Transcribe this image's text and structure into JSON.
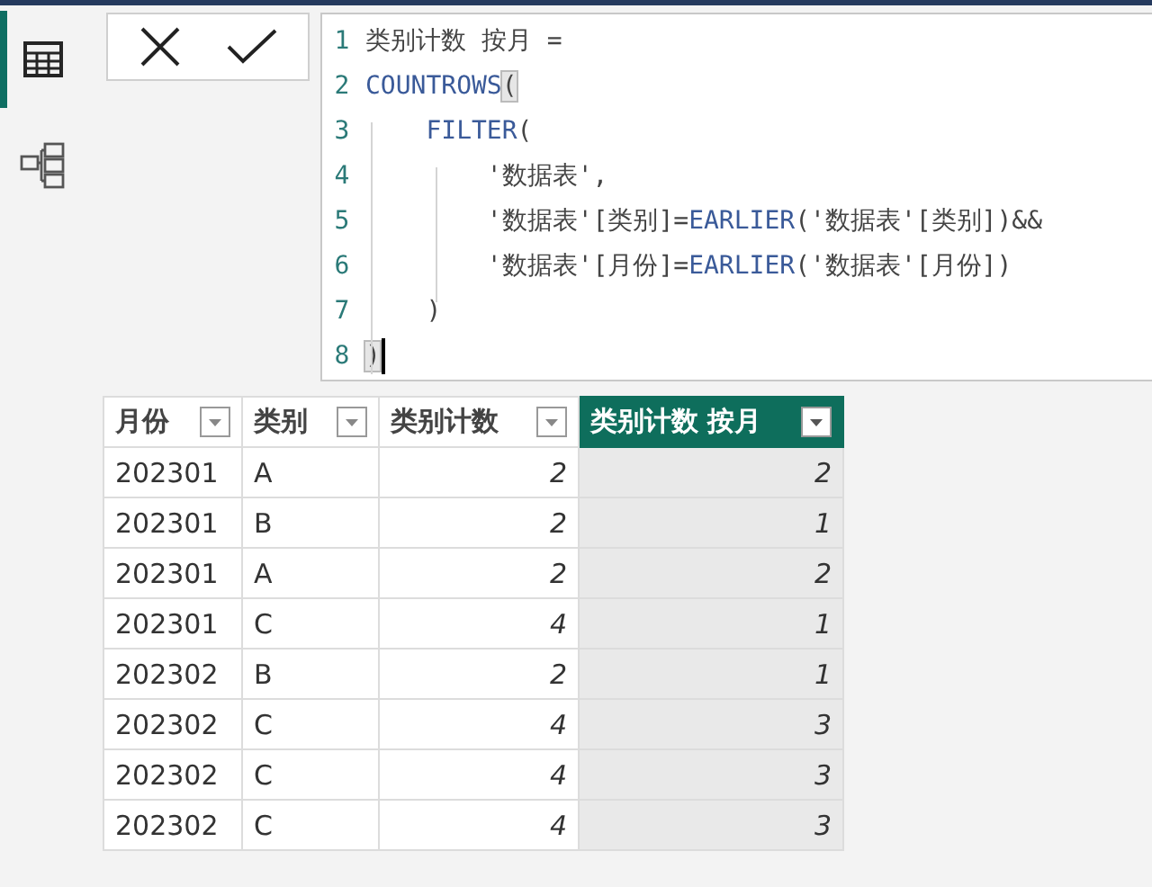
{
  "sidebar": {
    "items": [
      {
        "kind": "table",
        "selected": true
      },
      {
        "kind": "model",
        "selected": false
      }
    ]
  },
  "formula_bar": {
    "buttons": [
      {
        "kind": "cancel"
      },
      {
        "kind": "commit"
      }
    ],
    "lines": [
      {
        "number": "1",
        "cursor": false,
        "segments": [
          {
            "text": "类别计数 按月 =",
            "kind": "plain",
            "highlight": false
          }
        ]
      },
      {
        "number": "2",
        "cursor": false,
        "segments": [
          {
            "text": "COUNTROWS",
            "kind": "function",
            "highlight": false
          },
          {
            "text": "(",
            "kind": "plain",
            "highlight": true
          }
        ]
      },
      {
        "number": "3",
        "cursor": false,
        "segments": [
          {
            "text": "    FILTER",
            "kind": "function",
            "highlight": false
          },
          {
            "text": "(",
            "kind": "plain",
            "highlight": false
          }
        ]
      },
      {
        "number": "4",
        "cursor": false,
        "segments": [
          {
            "text": "        '数据表',",
            "kind": "plain",
            "highlight": false
          }
        ]
      },
      {
        "number": "5",
        "cursor": false,
        "segments": [
          {
            "text": "        '数据表'[类别]=",
            "kind": "plain",
            "highlight": false
          },
          {
            "text": "EARLIER",
            "kind": "function",
            "highlight": false
          },
          {
            "text": "('数据表'[类别])&&",
            "kind": "plain",
            "highlight": false
          }
        ]
      },
      {
        "number": "6",
        "cursor": false,
        "segments": [
          {
            "text": "        '数据表'[月份]=",
            "kind": "plain",
            "highlight": false
          },
          {
            "text": "EARLIER",
            "kind": "function",
            "highlight": false
          },
          {
            "text": "('数据表'[月份])",
            "kind": "plain",
            "highlight": false
          }
        ]
      },
      {
        "number": "7",
        "cursor": false,
        "segments": [
          {
            "text": "    )",
            "kind": "plain",
            "highlight": false
          }
        ]
      },
      {
        "number": "8",
        "cursor": true,
        "segments": [
          {
            "text": ")",
            "kind": "plain",
            "highlight": true
          }
        ]
      }
    ]
  },
  "table": {
    "columns": [
      {
        "label": "月份",
        "kind": "text",
        "selected": false
      },
      {
        "label": "类别",
        "kind": "text",
        "selected": false
      },
      {
        "label": "类别计数",
        "kind": "number",
        "selected": false
      },
      {
        "label": "类别计数 按月",
        "kind": "number",
        "selected": true
      }
    ],
    "rows": [
      [
        "202301",
        "A",
        "2",
        "2"
      ],
      [
        "202301",
        "B",
        "2",
        "1"
      ],
      [
        "202301",
        "A",
        "2",
        "2"
      ],
      [
        "202301",
        "C",
        "4",
        "1"
      ],
      [
        "202302",
        "B",
        "2",
        "1"
      ],
      [
        "202302",
        "C",
        "4",
        "3"
      ],
      [
        "202302",
        "C",
        "4",
        "3"
      ],
      [
        "202302",
        "C",
        "4",
        "3"
      ]
    ]
  }
}
